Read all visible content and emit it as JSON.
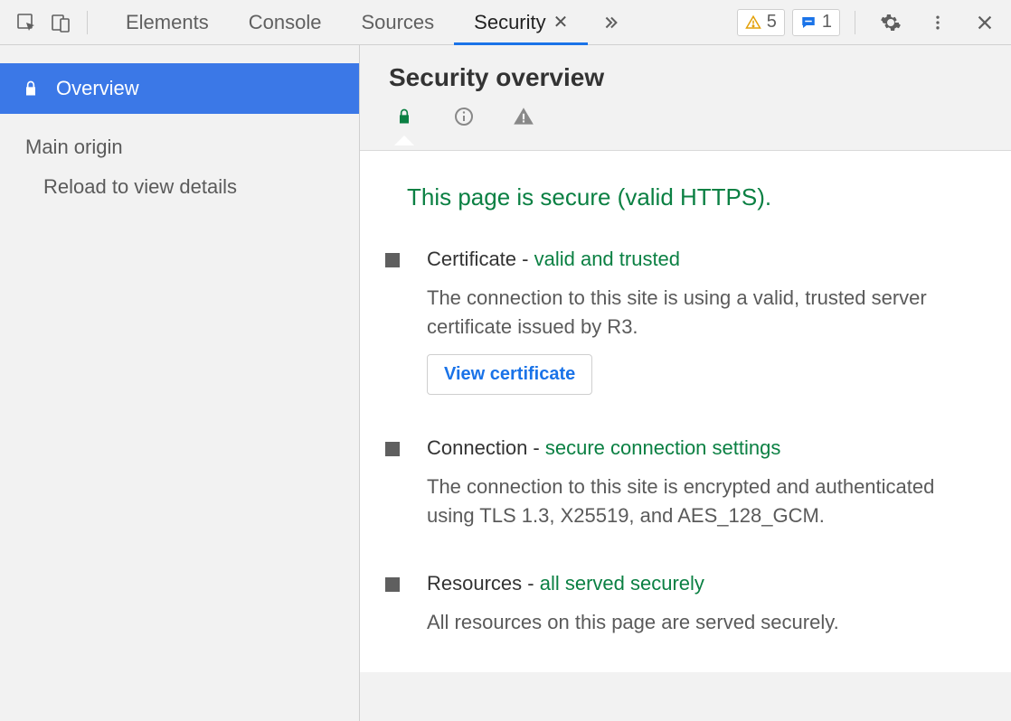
{
  "toolbar": {
    "tabs": {
      "elements": "Elements",
      "console": "Console",
      "sources": "Sources",
      "security": "Security"
    },
    "warn_count": "5",
    "info_count": "1"
  },
  "sidebar": {
    "overview": "Overview",
    "main_origin": "Main origin",
    "reload_hint": "Reload to view details"
  },
  "main": {
    "title": "Security overview",
    "secure_line": "This page is secure (valid HTTPS).",
    "cert": {
      "title_a": "Certificate - ",
      "title_b": "valid and trusted",
      "desc": "The connection to this site is using a valid, trusted server certificate issued by R3.",
      "button": "View certificate"
    },
    "conn": {
      "title_a": "Connection - ",
      "title_b": "secure connection settings",
      "desc": "The connection to this site is encrypted and authenticated using TLS 1.3, X25519, and AES_128_GCM."
    },
    "res": {
      "title_a": "Resources - ",
      "title_b": "all served securely",
      "desc": "All resources on this page are served securely."
    }
  }
}
